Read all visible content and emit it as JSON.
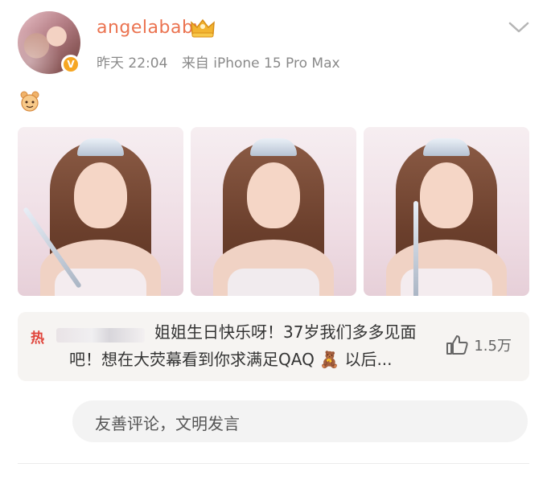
{
  "post": {
    "username": "angelababy",
    "time": "昨天 22:04",
    "source": "来自 iPhone 15 Pro Max",
    "emoji_icon": "bear-emoji"
  },
  "photos": [
    {
      "alt": "photo-1"
    },
    {
      "alt": "photo-2"
    },
    {
      "alt": "photo-3"
    }
  ],
  "hot_comment": {
    "badge": "热",
    "text": "姐姐生日快乐呀！37岁我们多多见面吧！想在大荧幕看到你求满足QAQ",
    "suffix": "以后...",
    "likes": "1.5万"
  },
  "composer": {
    "placeholder": "友善评论，文明发言"
  },
  "colors": {
    "username": "#eb7350",
    "hot": "#e0443b",
    "verified": "#f6a623"
  }
}
